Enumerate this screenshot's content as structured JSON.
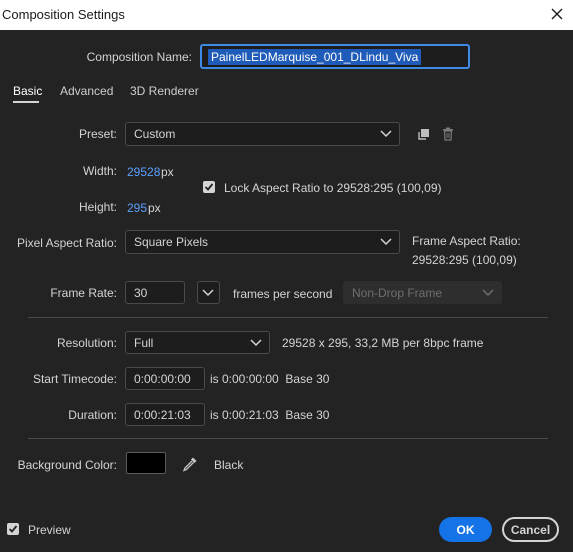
{
  "window": {
    "title": "Composition Settings"
  },
  "composition_name": {
    "label": "Composition Name:",
    "value": "PainelLEDMarquise_001_DLindu_Viva"
  },
  "tabs": [
    {
      "label": "Basic",
      "active": true
    },
    {
      "label": "Advanced",
      "active": false
    },
    {
      "label": "3D Renderer",
      "active": false
    }
  ],
  "preset": {
    "label": "Preset:",
    "value": "Custom"
  },
  "width": {
    "label": "Width:",
    "value": "29528",
    "unit": "px"
  },
  "height": {
    "label": "Height:",
    "value": "295",
    "unit": "px"
  },
  "lock_aspect": {
    "checked": true,
    "label": "Lock Aspect Ratio to 29528:295 (100,09)"
  },
  "pixel_aspect": {
    "label": "Pixel Aspect Ratio:",
    "value": "Square Pixels"
  },
  "frame_aspect": {
    "label": "Frame Aspect Ratio:",
    "value": "29528:295 (100,09)"
  },
  "frame_rate": {
    "label": "Frame Rate:",
    "value": "30",
    "unit": "frames per second",
    "drop_frame": "Non-Drop Frame"
  },
  "resolution": {
    "label": "Resolution:",
    "value": "Full",
    "info": "29528 x 295, 33,2 MB per 8bpc frame"
  },
  "start_timecode": {
    "label": "Start Timecode:",
    "value": "0:00:00:00",
    "info": "is 0:00:00:00  Base 30"
  },
  "duration": {
    "label": "Duration:",
    "value": "0:00:21:03",
    "info": "is 0:00:21:03  Base 30"
  },
  "background_color": {
    "label": "Background Color:",
    "swatch": "#000000",
    "name": "Black"
  },
  "footer": {
    "preview_label": "Preview",
    "preview_checked": true,
    "ok_label": "OK",
    "cancel_label": "Cancel"
  },
  "colors": {
    "accent": "#1473e6",
    "link": "#5ba0ff",
    "background": "#232323"
  }
}
